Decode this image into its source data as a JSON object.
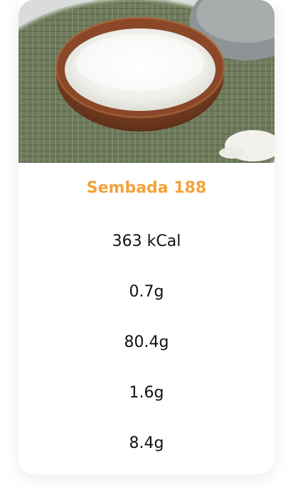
{
  "product": {
    "name": "Sembada 188",
    "image_alt": "Bowl of white rice",
    "accent_color": "#f0a33a"
  },
  "nutrition": [
    {
      "value": "363 kCal"
    },
    {
      "value": "0.7g"
    },
    {
      "value": "80.4g"
    },
    {
      "value": "1.6g"
    },
    {
      "value": "8.4g"
    }
  ]
}
